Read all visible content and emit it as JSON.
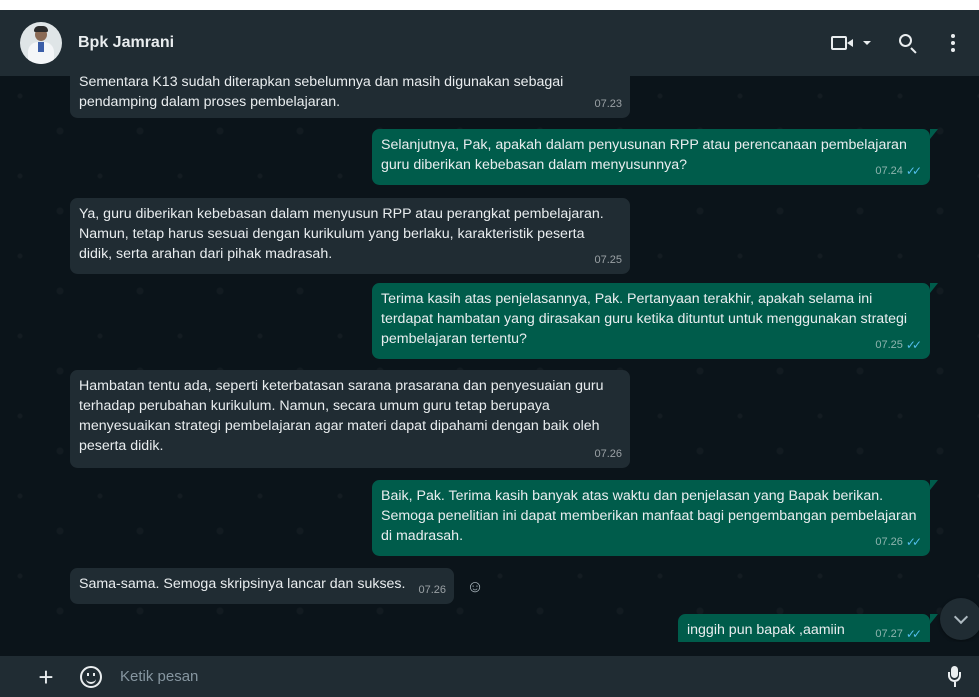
{
  "header": {
    "contact_name": "Bpk Jamrani",
    "icons": [
      "video-call-icon",
      "search-icon",
      "menu-icon"
    ]
  },
  "messages": [
    {
      "dir": "in",
      "text": "Sementara K13 sudah diterapkan sebelumnya dan masih digunakan sebagai pendamping dalam proses pembelajaran.",
      "time": "07.23"
    },
    {
      "dir": "out",
      "text": "Selanjutnya, Pak, apakah dalam penyusunan RPP atau perencanaan pembelajaran guru diberikan kebebasan dalam menyusunnya?",
      "time": "07.24"
    },
    {
      "dir": "in",
      "text": "Ya, guru diberikan kebebasan dalam menyusun RPP atau perangkat pembelajaran. Namun, tetap harus sesuai dengan kurikulum yang berlaku, karakteristik peserta didik, serta arahan dari pihak madrasah.",
      "time": "07.25"
    },
    {
      "dir": "out",
      "text": "Terima kasih atas penjelasannya, Pak. Pertanyaan terakhir, apakah selama ini terdapat hambatan yang dirasakan guru ketika dituntut untuk menggunakan strategi pembelajaran tertentu?",
      "time": "07.25"
    },
    {
      "dir": "in",
      "text": "Hambatan tentu ada, seperti keterbatasan sarana prasarana dan penyesuaian guru terhadap perubahan kurikulum. Namun, secara umum guru tetap berupaya menyesuaikan strategi pembelajaran agar materi dapat dipahami dengan baik oleh peserta didik.",
      "time": "07.26"
    },
    {
      "dir": "out",
      "text": "Baik, Pak. Terima kasih banyak atas waktu dan penjelasan yang Bapak berikan. Semoga penelitian ini dapat memberikan manfaat bagi pengembangan pembelajaran di madrasah.",
      "time": "07.26"
    },
    {
      "dir": "in",
      "text": "Sama-sama. Semoga skripsinya lancar dan sukses.",
      "time": "07.26"
    },
    {
      "dir": "out",
      "text": "inggih pun bapak ,aamiin🤲",
      "time": "07.27"
    }
  ],
  "composer": {
    "placeholder": "Ketik pesan"
  },
  "colors": {
    "background": "#0b141a",
    "panel": "#202c33",
    "outgoing_bubble": "#005c4b",
    "incoming_bubble": "#202c33",
    "read_tick": "#53bdeb"
  }
}
